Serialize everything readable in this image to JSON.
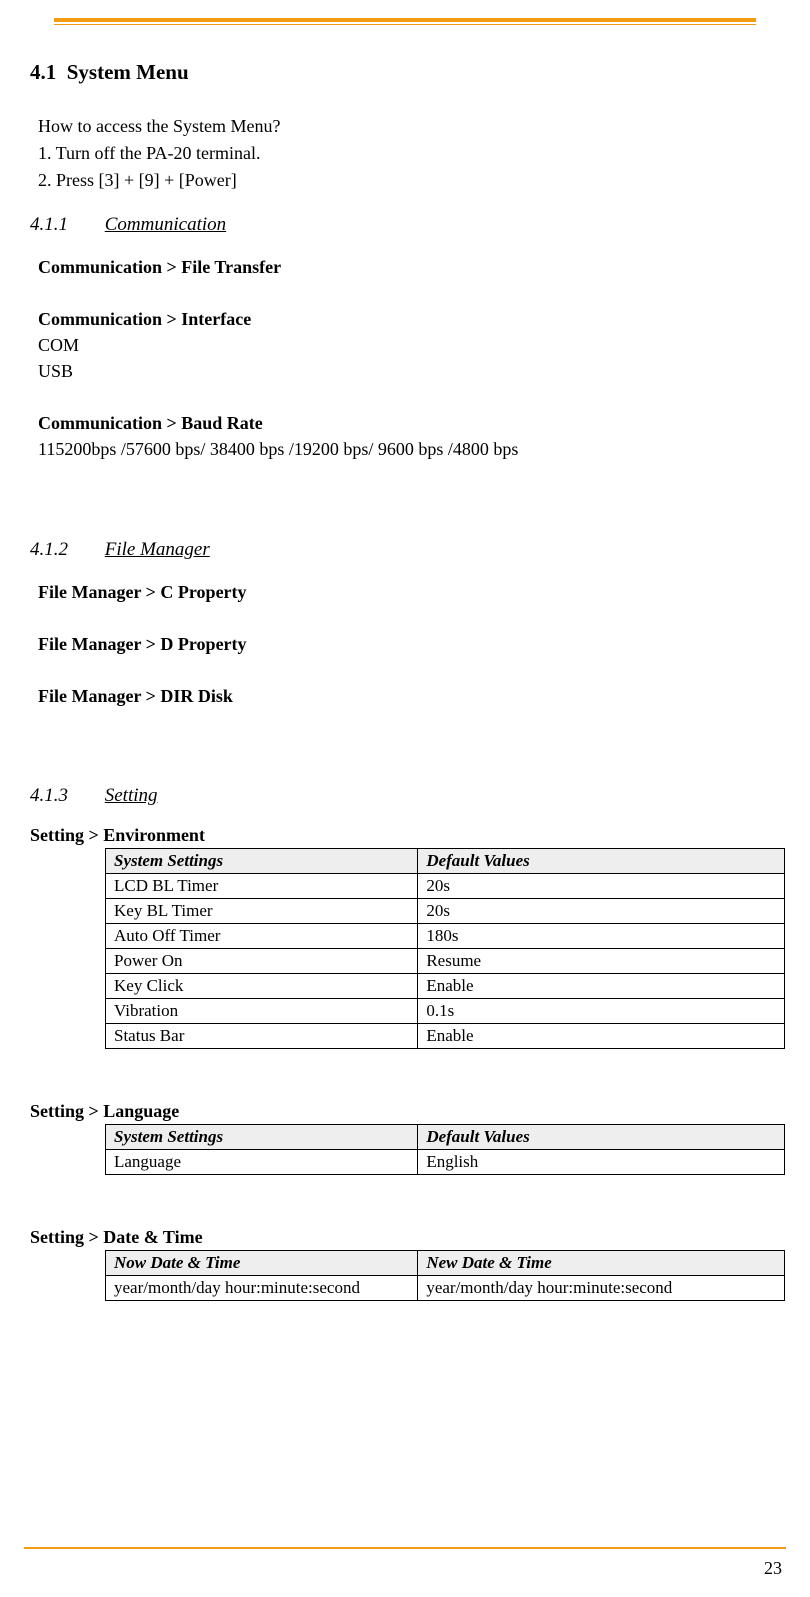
{
  "page_number": "23",
  "section": {
    "number": "4.1",
    "title": "System Menu"
  },
  "intro": {
    "q": "How to access the System Menu?",
    "step1": "1. Turn off the PA-20 terminal.",
    "step2": "2. Press [3] + [9] + [Power]"
  },
  "s411": {
    "num": "4.1.1",
    "title": "Communication",
    "file_transfer": "Communication > File Transfer",
    "interface_h": "Communication > Interface",
    "interface_opts": [
      "COM",
      "USB"
    ],
    "baud_h": "Communication > Baud Rate",
    "baud_opts": "115200bps /57600 bps/ 38400 bps /19200 bps/ 9600 bps /4800 bps"
  },
  "s412": {
    "num": "4.1.2",
    "title": "File Manager",
    "items": [
      "File Manager > C Property",
      "File Manager > D Property",
      "File Manager > DIR Disk"
    ]
  },
  "s413": {
    "num": "4.1.3",
    "title": "Setting",
    "env_label": "Setting > Environment",
    "env_headers": {
      "c1": "System Settings",
      "c2": "Default Values"
    },
    "env_rows": [
      {
        "name": "LCD BL Timer",
        "val": "20s"
      },
      {
        "name": "Key BL Timer",
        "val": "20s"
      },
      {
        "name": "Auto Off Timer",
        "val": "180s"
      },
      {
        "name": "Power On",
        "val": "Resume"
      },
      {
        "name": "Key Click",
        "val": "Enable"
      },
      {
        "name": "Vibration",
        "val": "0.1s"
      },
      {
        "name": "Status Bar",
        "val": "Enable"
      }
    ],
    "lang_label": "Setting > Language",
    "lang_headers": {
      "c1": "System Settings",
      "c2": "Default Values"
    },
    "lang_rows": [
      {
        "name": "Language",
        "val": "English"
      }
    ],
    "dt_label": "Setting > Date & Time",
    "dt_headers": {
      "c1": "Now Date & Time",
      "c2": "New Date & Time"
    },
    "dt_rows": [
      {
        "name": "year/month/day  hour:minute:second",
        "val": "year/month/day  hour:minute:second"
      }
    ]
  }
}
